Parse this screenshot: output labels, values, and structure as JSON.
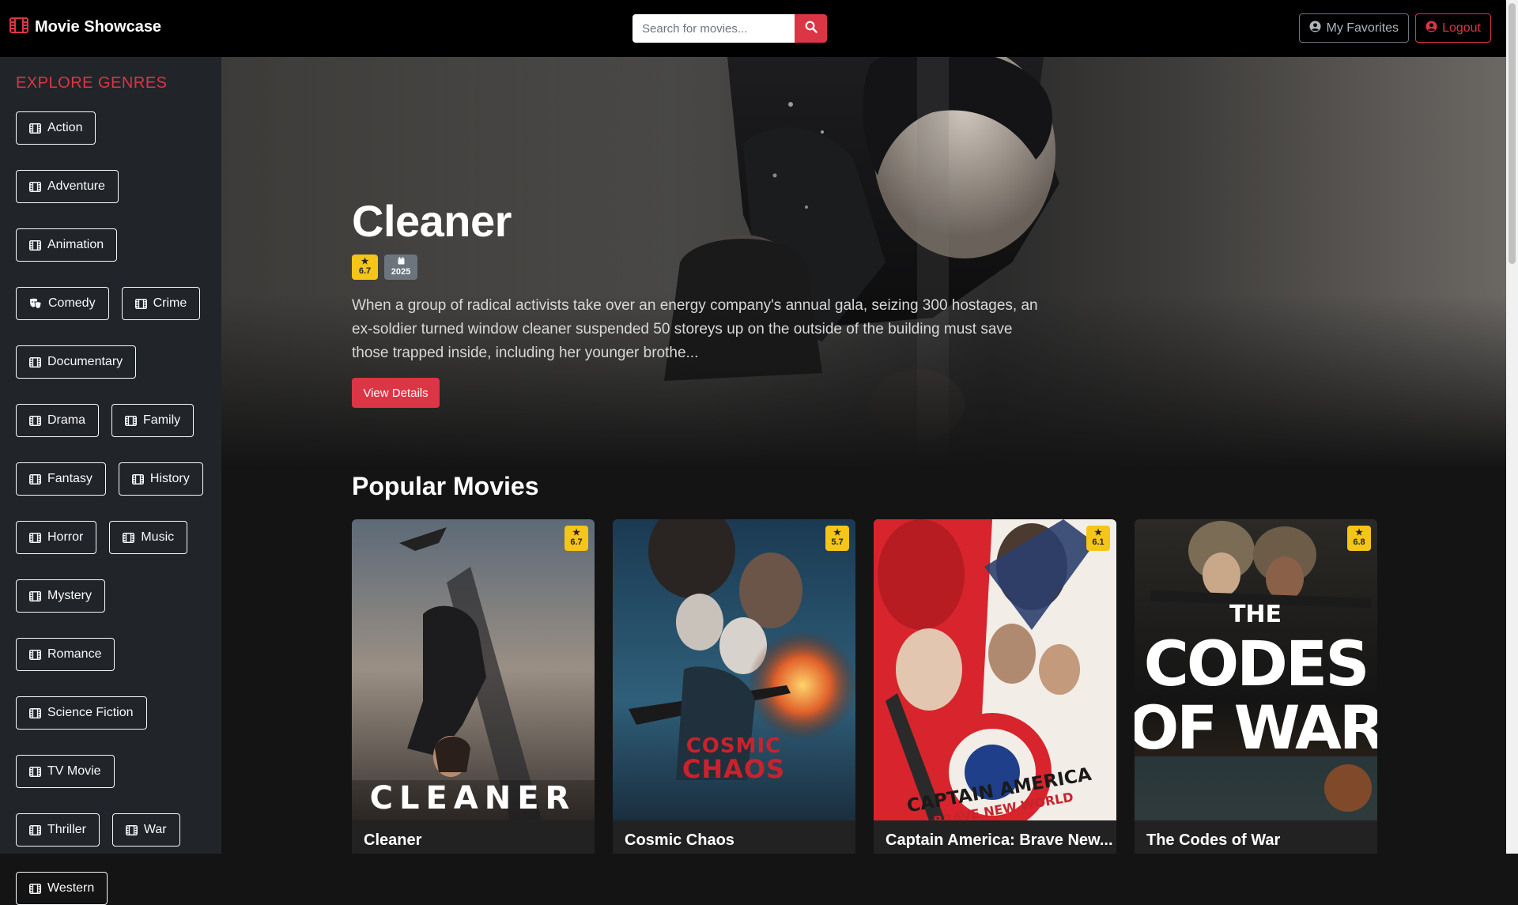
{
  "navbar": {
    "brand": "Movie Showcase",
    "brand_icon": "film-icon",
    "search_placeholder": "Search for movies...",
    "favorites_label": "My Favorites",
    "logout_label": "Logout",
    "accent": "#dc3545"
  },
  "sidebar": {
    "title": "EXPLORE GENRES",
    "genres": [
      {
        "label": "Action",
        "icon": "film-icon"
      },
      {
        "label": "Adventure",
        "icon": "film-icon"
      },
      {
        "label": "Animation",
        "icon": "film-icon"
      },
      {
        "label": "Comedy",
        "icon": "theater-masks-icon"
      },
      {
        "label": "Crime",
        "icon": "film-icon"
      },
      {
        "label": "Documentary",
        "icon": "film-icon"
      },
      {
        "label": "Drama",
        "icon": "film-icon"
      },
      {
        "label": "Family",
        "icon": "film-icon"
      },
      {
        "label": "Fantasy",
        "icon": "film-icon"
      },
      {
        "label": "History",
        "icon": "film-icon"
      },
      {
        "label": "Horror",
        "icon": "film-icon"
      },
      {
        "label": "Music",
        "icon": "film-icon"
      },
      {
        "label": "Mystery",
        "icon": "film-icon"
      },
      {
        "label": "Romance",
        "icon": "film-icon"
      },
      {
        "label": "Science Fiction",
        "icon": "film-icon"
      },
      {
        "label": "TV Movie",
        "icon": "film-icon"
      },
      {
        "label": "Thriller",
        "icon": "film-icon"
      },
      {
        "label": "War",
        "icon": "film-icon"
      },
      {
        "label": "Western",
        "icon": "film-icon"
      }
    ]
  },
  "hero": {
    "title": "Cleaner",
    "rating": "6.7",
    "year": "2025",
    "description": "When a group of radical activists take over an energy company's annual gala, seizing 300 hostages, an ex-soldier turned window cleaner suspended 50 storeys up on the outside of the building must save those trapped inside, including her younger brothe...",
    "button_label": "View Details"
  },
  "popular": {
    "title": "Popular Movies",
    "movies": [
      {
        "title": "Cleaner",
        "rating": "6.7",
        "poster_text": "CLEANER"
      },
      {
        "title": "Cosmic Chaos",
        "rating": "5.7",
        "poster_text": "COSMIC CHAOS"
      },
      {
        "title": "Captain America: Brave New...",
        "rating": "6.1",
        "poster_text": "CAPTAIN AMERICA BRAVE NEW WORLD"
      },
      {
        "title": "The Codes of War",
        "rating": "6.8",
        "poster_text": "THE CODES OF WAR"
      }
    ]
  }
}
